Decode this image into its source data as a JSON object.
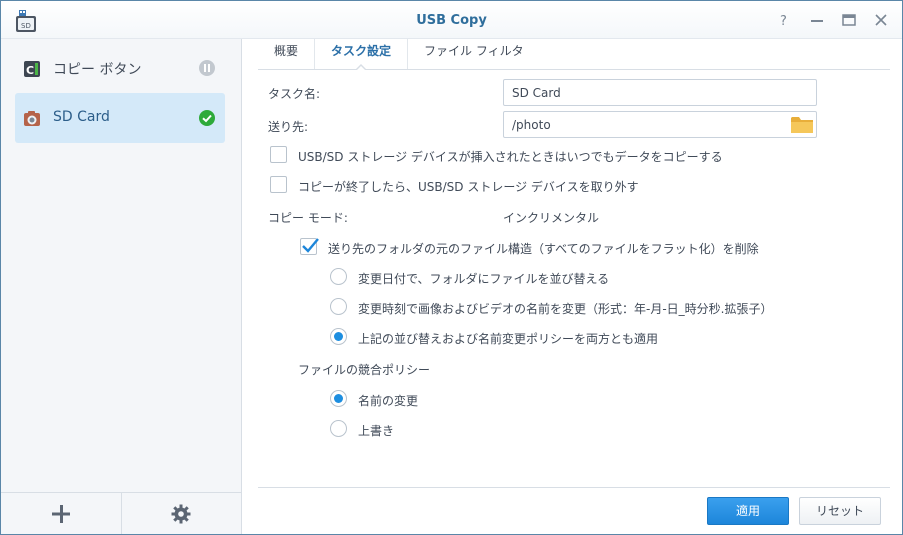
{
  "window": {
    "title": "USB Copy",
    "controls": [
      "help-icon",
      "minimize-icon",
      "maximize-icon",
      "close-icon"
    ]
  },
  "sidebar": {
    "items": [
      {
        "label": "コピー ボタン",
        "icon": "copy-button-icon",
        "state": "paused",
        "selected": false
      },
      {
        "label": "SD Card",
        "icon": "camera-icon",
        "state": "ok",
        "selected": true
      }
    ],
    "footer": {
      "add_icon": "plus-icon",
      "settings_icon": "gear-icon"
    }
  },
  "tabs": [
    {
      "label": "概要",
      "active": false
    },
    {
      "label": "タスク設定",
      "active": true
    },
    {
      "label": "ファイル フィルタ",
      "active": false
    }
  ],
  "form": {
    "task_name_label": "タスク名:",
    "task_name_value": "SD Card",
    "destination_label": "送り先:",
    "destination_value": "/photo",
    "auto_copy_label": "USB/SD ストレージ デバイスが挿入されたときはいつでもデータをコピーする",
    "auto_copy_checked": false,
    "eject_label": "コピーが終了したら、USB/SD ストレージ デバイスを取り外す",
    "eject_checked": false,
    "copy_mode_label": "コピー モード:",
    "copy_mode_value": "インクリメンタル",
    "flatten_label": "送り先のフォルダの元のファイル構造（すべてのファイルをフラット化）を削除",
    "flatten_checked": true,
    "sort_options": [
      {
        "label": "変更日付で、フォルダにファイルを並び替える",
        "selected": false
      },
      {
        "label": "変更時刻で画像およびビデオの名前を変更（形式：年-月-日_時分秒.拡張子）",
        "selected": false
      },
      {
        "label": "上記の並び替えおよび名前変更ポリシーを両方とも適用",
        "selected": true
      }
    ],
    "conflict_policy_label": "ファイルの競合ポリシー",
    "conflict_options": [
      {
        "label": "名前の変更",
        "selected": true
      },
      {
        "label": "上書き",
        "selected": false
      }
    ]
  },
  "buttons": {
    "apply_label": "適用",
    "reset_label": "リセット"
  },
  "colors": {
    "accent": "#1d86da",
    "title": "#2f6e9c",
    "selected_bg": "#d4e9f9",
    "ok_green": "#2eaa3a"
  }
}
